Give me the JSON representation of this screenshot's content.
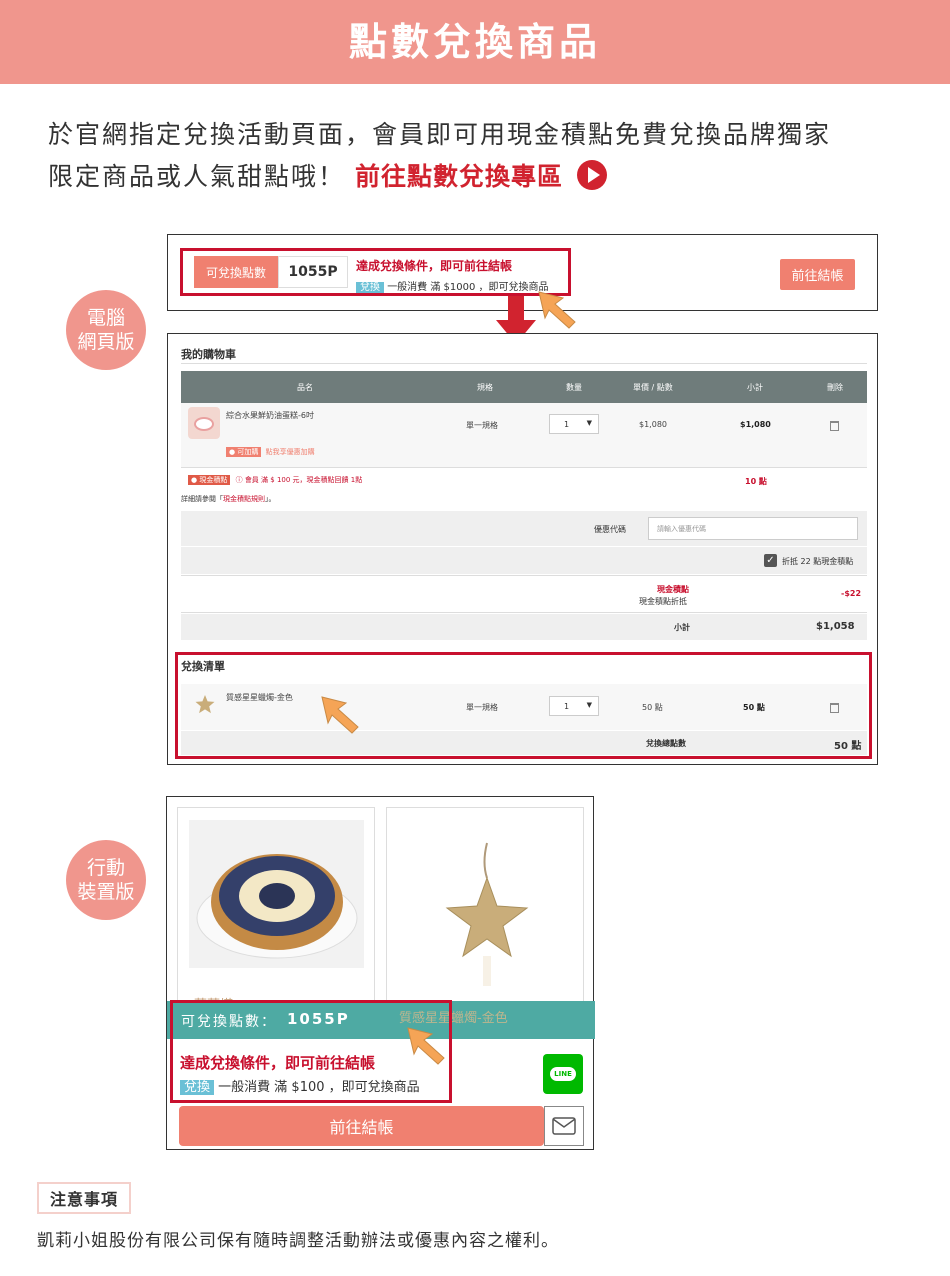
{
  "header": {
    "title": "點數兌換商品"
  },
  "intro": {
    "line1": "於官網指定兌換活動頁面，會員即可用現金積點免費兌換品牌獨家",
    "line2": "限定商品或人氣甜點哦！",
    "link": "前往點數兌換專區"
  },
  "badges": {
    "desktop": "電腦\n網頁版",
    "mobile": "行動\n裝置版"
  },
  "desktop": {
    "points_label": "可兌換點數",
    "points_value": "1055P",
    "condition": "達成兌換條件，即可前往結帳",
    "tag": "兌換",
    "rule": "一般消費 滿 $1000 ，即可兌換商品",
    "checkout": "前往結帳",
    "cart": {
      "title": "我的購物車",
      "headers": [
        "品名",
        "規格",
        "數量",
        "單價 / 點數",
        "小計",
        "刪除"
      ],
      "item": {
        "name": "綜合水果鮮奶油蛋糕-6吋",
        "spec": "單一規格",
        "qty": "1",
        "price": "$1,080",
        "subtotal": "$1,080"
      },
      "addon_tag": "● 可加購",
      "addon_link": "點我享優惠加購",
      "cash_tag": "● 現金積點",
      "cash_rule": "會員 滿 $ 100 元，現金積點回饋 1點",
      "cash_points": "10 點",
      "cash_detail_prefix": "詳細請參閱「",
      "cash_detail_link": "現金積點規則",
      "cash_detail_suffix": "」。",
      "coupon_label": "優惠代碼",
      "coupon_placeholder": "請輸入優惠代碼",
      "deduct_label": "折抵 22 點現金積點",
      "discount_red": "現金積點",
      "discount_label": "現金積點折抵",
      "discount_value": "-$22",
      "subtotal_label": "小計",
      "subtotal_value": "$1,058"
    },
    "exchange": {
      "title": "兌換清單",
      "item": {
        "name": "質感星星蠟燭-金色",
        "spec": "單一規格",
        "qty": "1",
        "points": "50 點",
        "subtotal": "50 點"
      },
      "total_label": "兌換總點數",
      "total_value": "50 點"
    }
  },
  "mobile": {
    "card1_name": "藍莓塔",
    "card2_name": "質感星星蠟燭-金色",
    "points_text": "可兌換點數：",
    "points_value": "1055P",
    "condition": "達成兌換條件，即可前往結帳",
    "tag": "兌換",
    "rule": "一般消費 滿 $100 ，即可兌換商品",
    "checkout": "前往結帳",
    "line_label": "LINE"
  },
  "notes": {
    "title": "注意事項",
    "text": "凱莉小姐股份有限公司保有隨時調整活動辦法或優惠內容之權利。"
  },
  "colors": {
    "salmon": "#f0968d",
    "red": "#c8102e",
    "teal": "#4eaaa3",
    "table_head": "#6f7c7b"
  }
}
